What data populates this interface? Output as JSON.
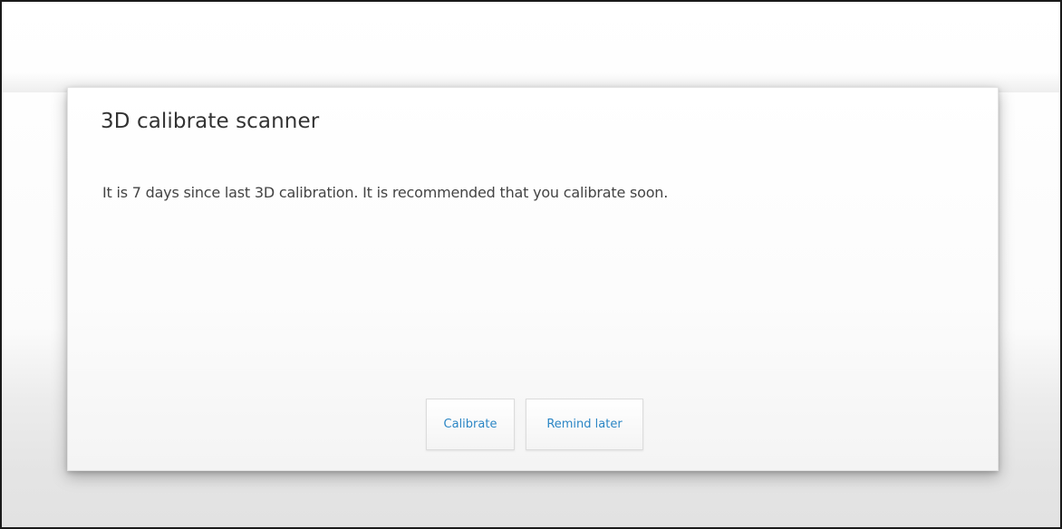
{
  "dialog": {
    "title": "3D calibrate scanner",
    "message": "It is 7 days since last 3D calibration. It is recommended that you calibrate soon.",
    "buttons": {
      "calibrate_label": "Calibrate",
      "remind_later_label": "Remind later"
    }
  },
  "colors": {
    "button_text": "#2b86c5",
    "title_text": "#333333",
    "body_text": "#444444"
  }
}
